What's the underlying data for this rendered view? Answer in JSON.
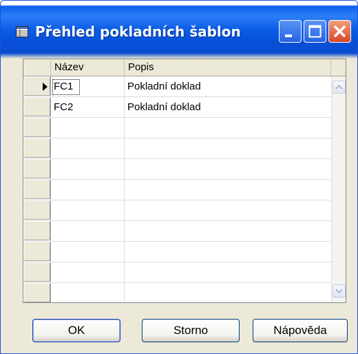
{
  "window": {
    "title": "Přehled pokladních šablon",
    "controls": {
      "minimize": "minimize-icon",
      "maximize": "maximize-icon",
      "close": "close-icon"
    }
  },
  "grid": {
    "columns": [
      "Název",
      "Popis"
    ],
    "rows": [
      {
        "name": "FC1",
        "description": "Pokladní doklad",
        "selected": true
      },
      {
        "name": "FC2",
        "description": "Pokladní doklad",
        "selected": false
      }
    ],
    "empty_rows": 9
  },
  "buttons": {
    "ok": "OK",
    "cancel": "Storno",
    "help": "Nápověda"
  },
  "colors": {
    "titlebar": "#0a5ce6",
    "close_button": "#d9442a",
    "dialog_background": "#ece9d8"
  }
}
